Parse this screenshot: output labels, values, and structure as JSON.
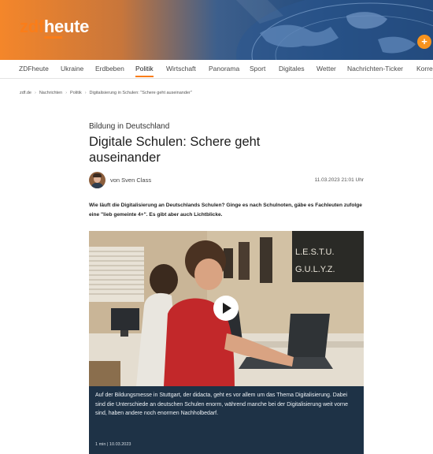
{
  "header": {
    "logo_zdf": "zdf",
    "logo_heute": "heute",
    "plus_label": "+"
  },
  "nav": {
    "items": [
      "ZDFheute",
      "Ukraine",
      "Erdbeben",
      "Politik",
      "Wirtschaft",
      "Panorama",
      "Sport",
      "Digitales",
      "Wetter",
      "Nachrichten-Ticker",
      "Korre"
    ],
    "active": "Politik"
  },
  "breadcrumb": {
    "items": [
      "zdf.de",
      "Nachrichten",
      "Politik",
      "Digitalisierung in Schulen: \"Schere geht auseinander\""
    ]
  },
  "article": {
    "kicker": "Bildung in Deutschland",
    "title": "Digitale Schulen: Schere geht auseinander",
    "author": "von Sven Class",
    "date": "11.03.2023 21:01 Uhr",
    "teaser": "Wie läuft die Digitalisierung an Deutschlands Schulen? Ginge es nach Schulnoten, gäbe es Fachleuten zufolge eine \"lieb gemeinte 4+\". Es gibt aber auch Lichtblicke."
  },
  "video": {
    "caption": "Auf der Bildungsmesse in Stuttgart, der didacta, geht es vor allem um das Thema Digitalisierung. Dabei sind die Unterschiede an deutschen Schulen enorm, während manche bei der Digitalisierung weit vorne sind, haben andere noch enormen Nachholbedarf.",
    "meta": "1 min | 10.03.2023",
    "board_text_1": "L.E.S.T.U.",
    "board_text_2": "G.U.L.Y.Z."
  },
  "colors": {
    "brand_orange": "#fa7d19",
    "header_blue": "#1c3e6b",
    "caption_bg": "#1e3246"
  }
}
